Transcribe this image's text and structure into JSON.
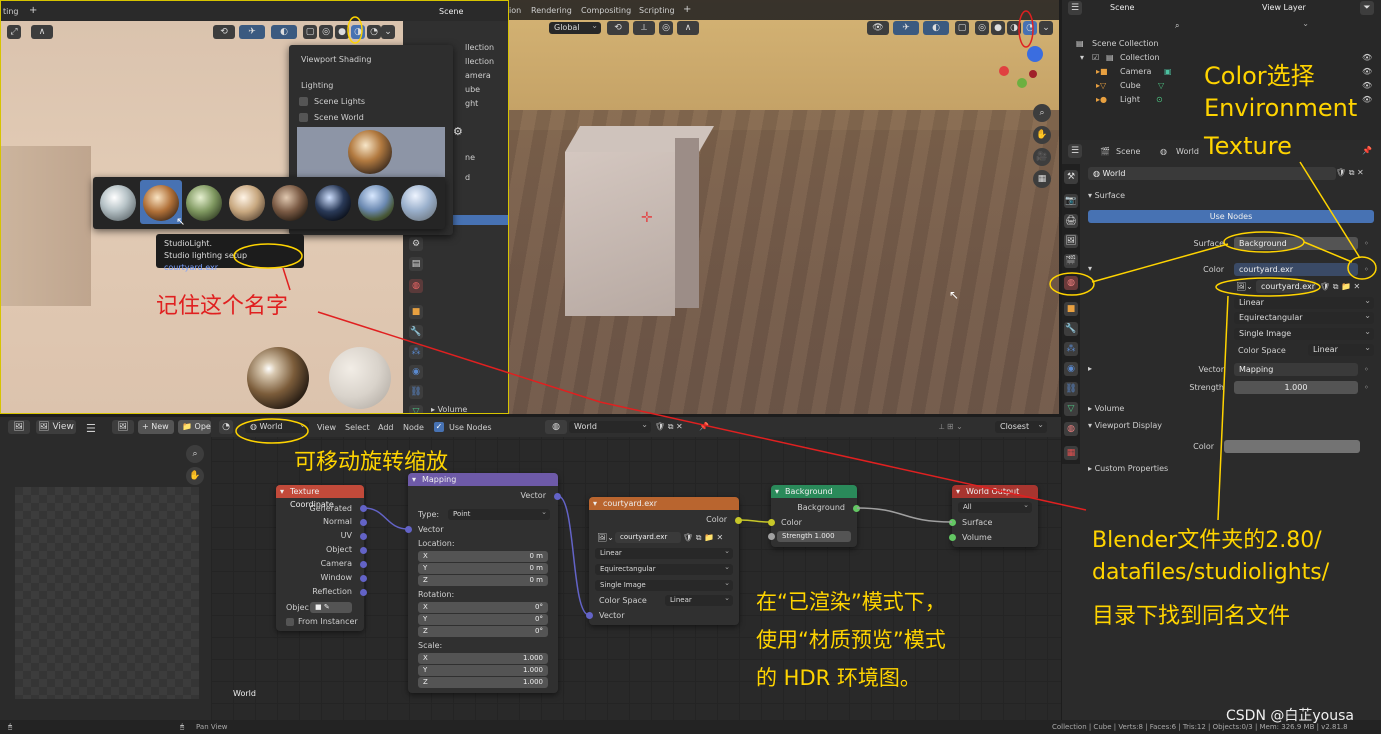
{
  "app": {
    "scene": "Scene",
    "view_layer": "View Layer",
    "workspace_tabs": [
      "ting",
      "Rendering",
      "Compositing",
      "Scripting"
    ],
    "partial_tab": "ion"
  },
  "viewport_left": {
    "popup_title": "Viewport Shading",
    "lighting_label": "Lighting",
    "scene_lights": "Scene Lights",
    "scene_world": "Scene World",
    "tooltip_line1": "StudioLight.",
    "tooltip_line2": "Studio lighting setup",
    "tooltip_file": "courtyard.exr",
    "outliner_partials": [
      "llection",
      "llection",
      "amera",
      "ube",
      "ght"
    ],
    "panel_partials": [
      "ne",
      "d"
    ],
    "volume_label": "Volume"
  },
  "viewport_right": {
    "orientation": "Global"
  },
  "outliner": {
    "items": [
      {
        "label": "Scene Collection",
        "icon": "collection-icon"
      },
      {
        "label": "Collection",
        "icon": "collection-icon"
      },
      {
        "label": "Camera",
        "icon": "camera-icon"
      },
      {
        "label": "Cube",
        "icon": "cube-icon"
      },
      {
        "label": "Light",
        "icon": "light-icon"
      }
    ]
  },
  "properties": {
    "breadcrumb_scene": "Scene",
    "breadcrumb_world": "World",
    "world_name": "World",
    "surface_panel": "Surface",
    "use_nodes": "Use Nodes",
    "surface_label": "Surface",
    "surface_value": "Background",
    "color_label": "Color",
    "color_value": "courtyard.exr",
    "image_name": "courtyard.exr",
    "interpolation": "Linear",
    "projection": "Equirectangular",
    "source": "Single Image",
    "color_space_label": "Color Space",
    "color_space_value": "Linear",
    "vector_label": "Vector",
    "vector_value": "Mapping",
    "strength_label": "Strength",
    "strength_value": "1.000",
    "volume_panel": "Volume",
    "viewport_display_panel": "Viewport Display",
    "vd_color_label": "Color",
    "custom_props_panel": "Custom Properties"
  },
  "image_editor": {
    "view": "View",
    "new": "New",
    "open": "Ope"
  },
  "node_editor": {
    "header": {
      "world_type": "World",
      "menus": [
        "View",
        "Select",
        "Add",
        "Node"
      ],
      "use_nodes": "Use Nodes",
      "world_name": "World",
      "filter": "Closest"
    },
    "footer_label": "World",
    "texcoord": {
      "title": "Texture Coordinate",
      "outputs": [
        "Generated",
        "Normal",
        "UV",
        "Object",
        "Camera",
        "Window",
        "Reflection"
      ],
      "object_label": "Objec",
      "from_instancer": "From Instancer"
    },
    "mapping": {
      "title": "Mapping",
      "output": "Vector",
      "type_label": "Type:",
      "type_value": "Point",
      "vector_label": "Vector",
      "location_label": "Location:",
      "location": [
        {
          "axis": "X",
          "value": "0 m"
        },
        {
          "axis": "Y",
          "value": "0 m"
        },
        {
          "axis": "Z",
          "value": "0 m"
        }
      ],
      "rotation_label": "Rotation:",
      "rotation": [
        {
          "axis": "X",
          "value": "0°"
        },
        {
          "axis": "Y",
          "value": "0°"
        },
        {
          "axis": "Z",
          "value": "0°"
        }
      ],
      "scale_label": "Scale:",
      "scale": [
        {
          "axis": "X",
          "value": "1.000"
        },
        {
          "axis": "Y",
          "value": "1.000"
        },
        {
          "axis": "Z",
          "value": "1.000"
        }
      ]
    },
    "envtex": {
      "title": "courtyard.exr",
      "output": "Color",
      "image": "courtyard.exr",
      "interp": "Linear",
      "projection": "Equirectangular",
      "source": "Single Image",
      "cs_label": "Color Space",
      "cs_value": "Linear",
      "vector": "Vector"
    },
    "background": {
      "title": "Background",
      "output": "Background",
      "color": "Color",
      "strength_label": "Strength",
      "strength_value": "1.000"
    },
    "output": {
      "title": "World Output",
      "target": "All",
      "surface": "Surface",
      "volume": "Volume"
    }
  },
  "annotations": {
    "remember_name": "记住这个名字",
    "color_choose_l1": "Color选择",
    "color_choose_l2": "Environment",
    "color_choose_l3": "Texture",
    "move_rotate_zoom": "可移动旋转缩放",
    "render_mode_l1": "在“已渲染”模式下，",
    "render_mode_l2": "使用“材质预览”模式",
    "render_mode_l3": "的 HDR 环境图。",
    "blender_path_l1": "Blender文件夹的2.80/",
    "blender_path_l2": "datafiles/studiolights/",
    "blender_path_l3": "目录下找到同名文件"
  },
  "statusbar": {
    "pan_view": "Pan View",
    "stats": "Collection | Cube | Verts:8 | Faces:6 | Tris:12 | Objects:0/3 | Mem: 326.9 MB | v2.81.8"
  },
  "watermark": "CSDN @白芷yousa",
  "colors": {
    "annotation_yellow": "#ffd400",
    "annotation_red": "#e02020",
    "use_nodes_blue": "#4772b3",
    "texcoord_header": "#c24a3a",
    "mapping_header": "#6e5aa8",
    "envtex_header": "#b9652f",
    "background_header": "#2a8a5a",
    "output_header": "#a8352f"
  }
}
